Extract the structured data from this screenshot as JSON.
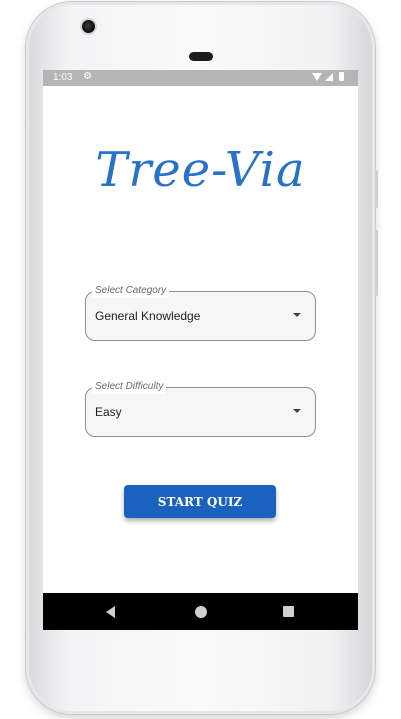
{
  "status_bar": {
    "time": "1:03",
    "settings_icon": "gear-icon"
  },
  "app": {
    "title": "Tree-Via"
  },
  "category": {
    "label": "Select Category",
    "value": "General Knowledge"
  },
  "difficulty": {
    "label": "Select Difficulty",
    "value": "Easy"
  },
  "start_button": {
    "label": "START QUIZ"
  },
  "colors": {
    "accent": "#1a62be",
    "title": "#2872c8",
    "status_bar": "#b5b5b5"
  },
  "nav_bar": {
    "back_icon": "back-triangle-icon",
    "home_icon": "home-circle-icon",
    "recent_icon": "recent-square-icon"
  }
}
